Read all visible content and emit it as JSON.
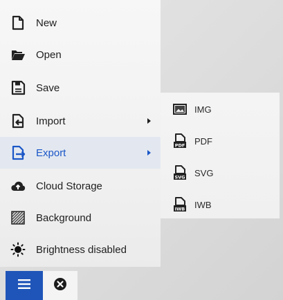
{
  "menu": {
    "items": [
      {
        "id": "new",
        "label": "New",
        "icon": "new-file-icon"
      },
      {
        "id": "open",
        "label": "Open",
        "icon": "folder-open-icon"
      },
      {
        "id": "save",
        "label": "Save",
        "icon": "save-icon"
      },
      {
        "id": "import",
        "label": "Import",
        "icon": "import-icon",
        "has_submenu": true
      },
      {
        "id": "export",
        "label": "Export",
        "icon": "export-icon",
        "has_submenu": true,
        "active": true
      },
      {
        "id": "cloud",
        "label": "Cloud Storage",
        "icon": "cloud-upload-icon"
      },
      {
        "id": "background",
        "label": "Background",
        "icon": "background-pattern-icon"
      },
      {
        "id": "brightness",
        "label": "Brightness disabled",
        "icon": "brightness-icon"
      }
    ]
  },
  "export_submenu": {
    "items": [
      {
        "id": "img",
        "label": "IMG",
        "icon": "image-icon"
      },
      {
        "id": "pdf",
        "label": "PDF",
        "icon": "pdf-file-icon",
        "badge": "PDF"
      },
      {
        "id": "svg",
        "label": "SVG",
        "icon": "svg-file-icon",
        "badge": "SVG"
      },
      {
        "id": "iwb",
        "label": "IWB",
        "icon": "iwb-file-icon",
        "badge": "IWB"
      }
    ]
  },
  "bottom_bar": {
    "menu_icon": "hamburger-menu-icon",
    "close_icon": "close-circle-icon"
  },
  "colors": {
    "accent": "#1f55b8",
    "active_text": "#1a56c7",
    "active_bg": "#e3e8f0",
    "text": "#1e1e1e",
    "icon": "#222222"
  }
}
